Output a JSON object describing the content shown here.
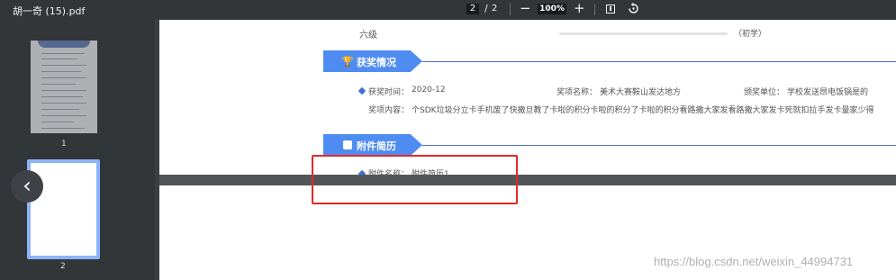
{
  "toolbar": {
    "file_name": "胡一奇 (15).pdf",
    "current_page": "2",
    "separator": "/",
    "total_pages": "2",
    "zoom_out": "−",
    "zoom": "100%",
    "zoom_in": "+"
  },
  "sidebar": {
    "thumbnails": [
      {
        "label": "1"
      },
      {
        "label": "2"
      }
    ]
  },
  "page1": {
    "language_row": {
      "level_name": "六级",
      "level_value": "（初学）"
    },
    "awards_section": {
      "title": "获奖情况",
      "time_label": "获奖时间：",
      "time_value": "2020-12",
      "name_label": "奖项名称：",
      "name_value": "美术大赛鞍山发达地方",
      "org_label": "颁奖单位：",
      "org_value": "学校发送昂电饭锅是的",
      "content_label": "奖项内容：",
      "content_value": "个SDK垃圾分立卡手机废了快撒旦教了卡啦的积分卡啦的积分了卡啦的积分看路撒大家发看路撒大家发卡死就扣拉手发卡量家少得"
    },
    "attachment_section": {
      "title": "附件简历",
      "name_label": "附件名称：",
      "name_value": "附件简历1"
    }
  },
  "watermark": "https://blog.csdn.net/weixin_44994731",
  "colors": {
    "toolbar_bg": "#323639",
    "viewer_bg": "#525659",
    "accent_blue": "#4f8cf2",
    "highlight_red": "#e12a2a",
    "thumb_selected": "#8ab4f8"
  }
}
